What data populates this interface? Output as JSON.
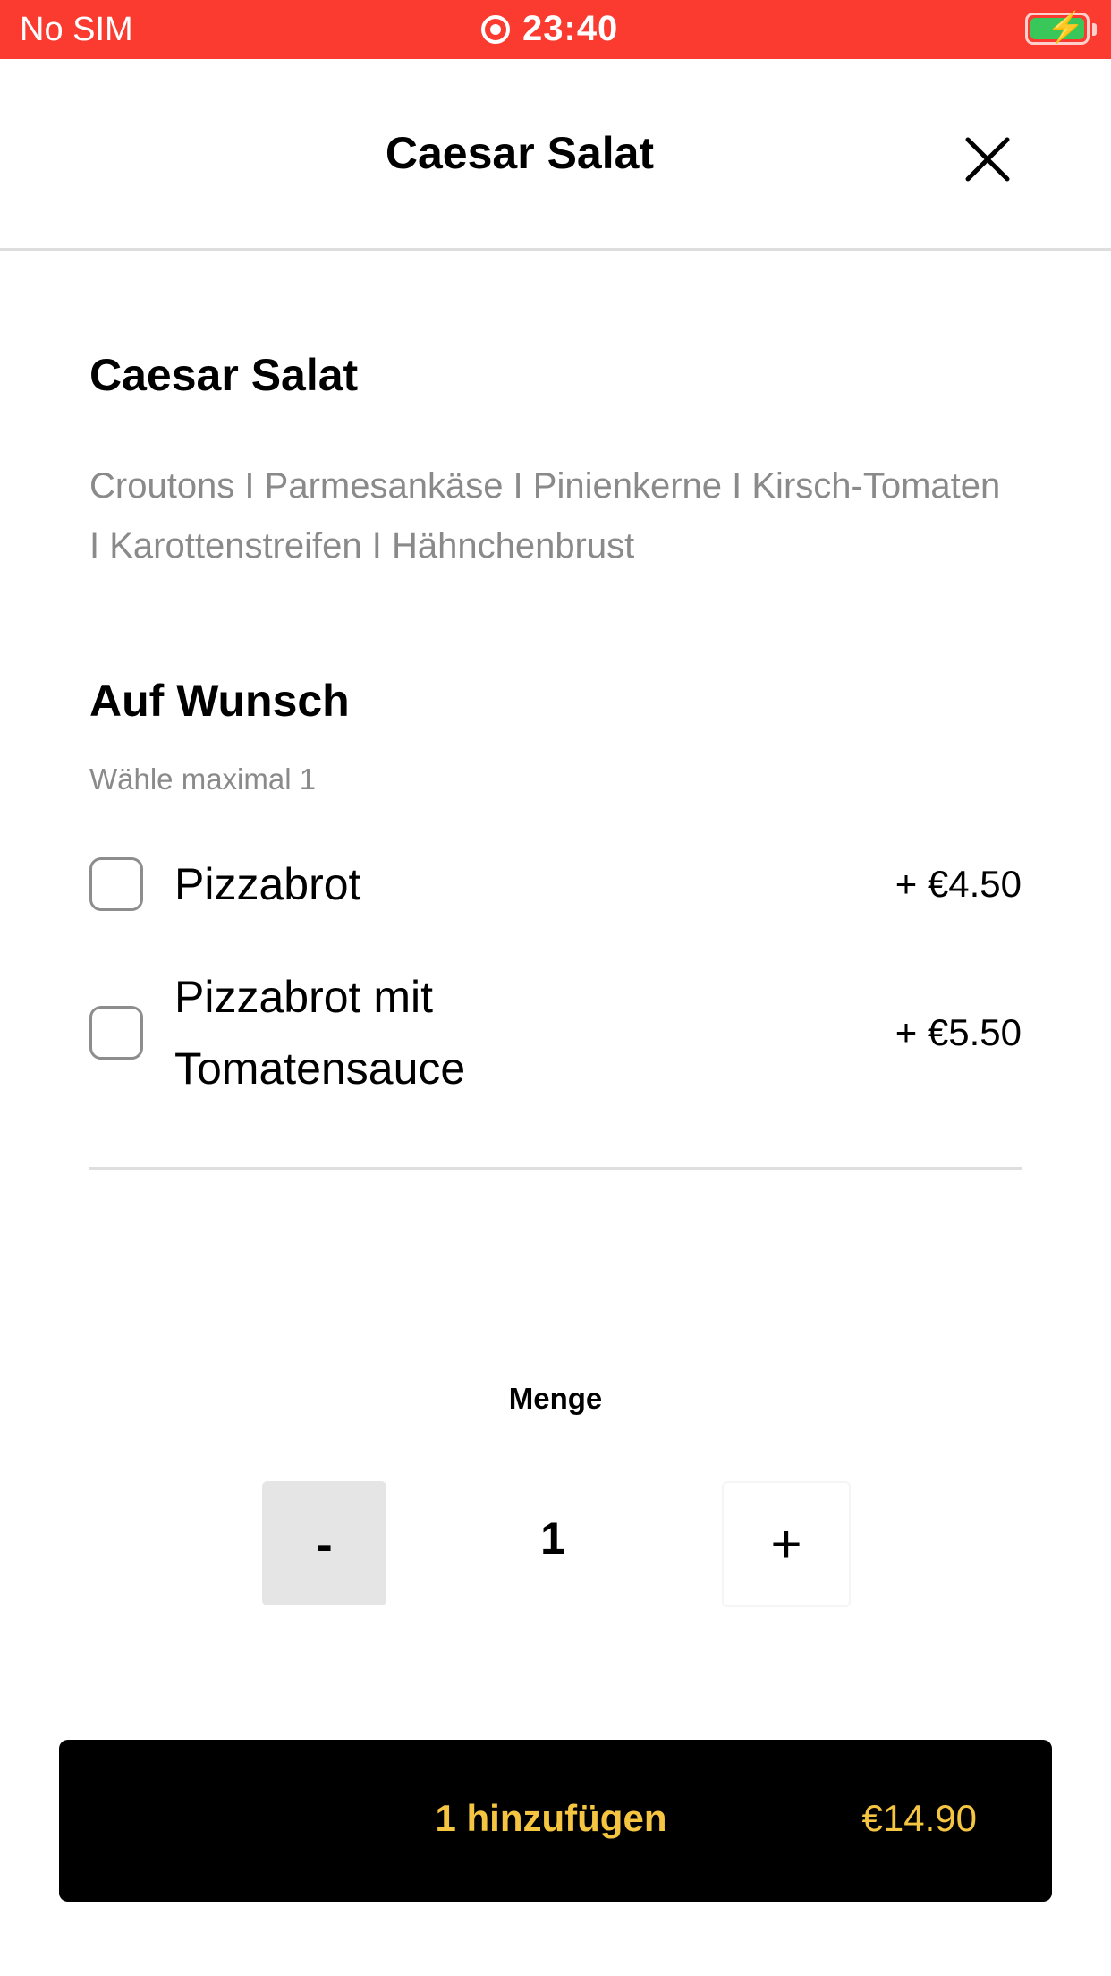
{
  "status_bar": {
    "carrier": "No SIM",
    "time": "23:40",
    "battery_icon": "battery-charging-icon",
    "location_icon": "screen-recording-icon"
  },
  "header": {
    "title": "Caesar Salat",
    "close_icon": "close-icon"
  },
  "item": {
    "name": "Caesar Salat",
    "description": "Croutons I Parmesankäse I Pinienkerne I Kirsch-Tomaten I Karottenstreifen I Hähnchenbrust"
  },
  "options_section": {
    "title": "Auf Wunsch",
    "subtitle": "Wähle maximal 1",
    "options": [
      {
        "label": "Pizzabrot",
        "price": "+ €4.50",
        "checked": false
      },
      {
        "label": "Pizzabrot mit Tomatensauce",
        "price": "+ €5.50",
        "checked": false
      }
    ]
  },
  "quantity": {
    "label": "Menge",
    "minus": "-",
    "value": "1",
    "plus": "+"
  },
  "add_button": {
    "label": "1 hinzufügen",
    "price": "€14.90"
  },
  "colors": {
    "status_bar": "#fb3a30",
    "button_bg": "#000000",
    "button_text": "#f5c542",
    "muted_text": "#8a8a8a"
  }
}
